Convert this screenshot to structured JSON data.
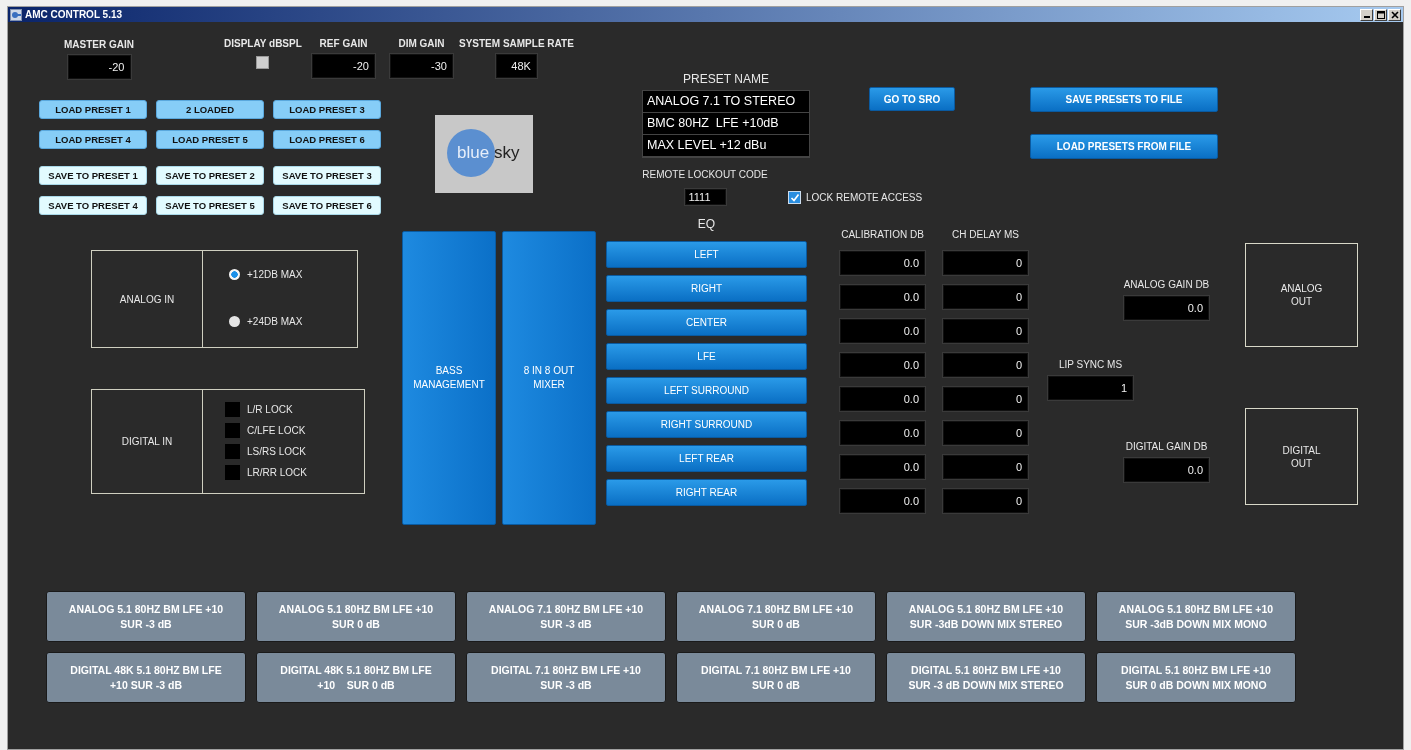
{
  "window": {
    "title": "AMC CONTROL 5.13"
  },
  "top_fields": [
    {
      "label": "MASTER GAIN",
      "value": "-20"
    },
    {
      "label": "REF GAIN",
      "value": "-20"
    },
    {
      "label": "DIM GAIN",
      "value": "-30"
    },
    {
      "label": "SYSTEM SAMPLE RATE",
      "value": "48K"
    }
  ],
  "display_dbspl": {
    "label": "DISPLAY dBSPL",
    "checked": false
  },
  "load_presets": [
    {
      "label": "LOAD PRESET 1"
    },
    {
      "label": "2 LOADED"
    },
    {
      "label": "LOAD PRESET 3"
    },
    {
      "label": "LOAD PRESET 4"
    },
    {
      "label": "LOAD PRESET 5"
    },
    {
      "label": "LOAD PRESET 6"
    }
  ],
  "save_presets": [
    {
      "label": "SAVE TO PRESET 1"
    },
    {
      "label": "SAVE TO PRESET 2"
    },
    {
      "label": "SAVE TO PRESET 3"
    },
    {
      "label": "SAVE TO PRESET 4"
    },
    {
      "label": "SAVE TO PRESET 5"
    },
    {
      "label": "SAVE TO PRESET 6"
    }
  ],
  "logo": {
    "part_1": "blue",
    "part_2": "sky"
  },
  "preset_name": {
    "label": "PRESET NAME",
    "lines": [
      "ANALOG 7.1 TO STEREO",
      "BMC 80HZ  LFE +10dB",
      "MAX LEVEL +12 dBu"
    ]
  },
  "go_to_sro": "GO TO SRO",
  "file_buttons": [
    "SAVE PRESETS TO FILE",
    "LOAD PRESETS FROM FILE"
  ],
  "remote_lockout": {
    "label": "REMOTE LOCKOUT CODE",
    "value": "1111"
  },
  "lock_remote_access": {
    "label": "LOCK REMOTE ACCESS",
    "checked": true
  },
  "analog_in": {
    "label": "ANALOG IN",
    "options": [
      {
        "label": "+12DB MAX",
        "selected": true
      },
      {
        "label": "+24DB MAX",
        "selected": false
      }
    ]
  },
  "digital_in": {
    "label": "DIGITAL IN",
    "locks": [
      {
        "label": "L/R LOCK",
        "on": false
      },
      {
        "label": "C/LFE LOCK",
        "on": false
      },
      {
        "label": "LS/RS LOCK",
        "on": false
      },
      {
        "label": "LR/RR LOCK",
        "on": false
      }
    ]
  },
  "big_buttons": [
    "BASS MANAGEMENT",
    "8 IN 8 OUT MIXER"
  ],
  "eq": {
    "label": "EQ",
    "channels": [
      "LEFT",
      "RIGHT",
      "CENTER",
      "LFE",
      "LEFT SURROUND",
      "RIGHT SURROUND",
      "LEFT REAR",
      "RIGHT REAR"
    ]
  },
  "calibration": {
    "label": "CALIBRATION DB",
    "values": [
      "0.0",
      "0.0",
      "0.0",
      "0.0",
      "0.0",
      "0.0",
      "0.0",
      "0.0"
    ]
  },
  "ch_delay": {
    "label": "CH DELAY MS",
    "values": [
      "0",
      "0",
      "0",
      "0",
      "0",
      "0",
      "0",
      "0"
    ]
  },
  "analog_gain": {
    "label": "ANALOG GAIN DB",
    "value": "0.0"
  },
  "lip_sync": {
    "label": "LIP SYNC MS",
    "value": "1"
  },
  "digital_gain": {
    "label": "DIGITAL GAIN DB",
    "value": "0.0"
  },
  "analog_out": "ANALOG OUT",
  "digital_out": "DIGITAL OUT",
  "quick_presets": [
    [
      "ANALOG 5.1 80HZ BM LFE +10 SUR -3 dB",
      "ANALOG 5.1 80HZ BM LFE +10 SUR 0 dB",
      "ANALOG 7.1 80HZ BM LFE +10 SUR -3 dB",
      "ANALOG 7.1 80HZ BM LFE +10 SUR 0 dB",
      "ANALOG 5.1 80HZ BM LFE +10 SUR -3dB DOWN MIX STEREO",
      "ANALOG 5.1 80HZ BM LFE +10 SUR -3dB DOWN MIX MONO"
    ],
    [
      "DIGITAL 48K 5.1 80HZ BM LFE +10 SUR -3 dB",
      "DIGITAL 48K 5.1 80HZ BM LFE +10    SUR 0 dB",
      "DIGITAL 7.1 80HZ BM LFE +10 SUR -3 dB",
      "DIGITAL 7.1 80HZ BM LFE +10 SUR 0 dB",
      "DIGITAL 5.1 80HZ BM LFE +10 SUR -3 dB DOWN MIX STEREO",
      "DIGITAL 5.1 80HZ BM LFE +10  SUR 0 dB DOWN MIX MONO"
    ]
  ]
}
